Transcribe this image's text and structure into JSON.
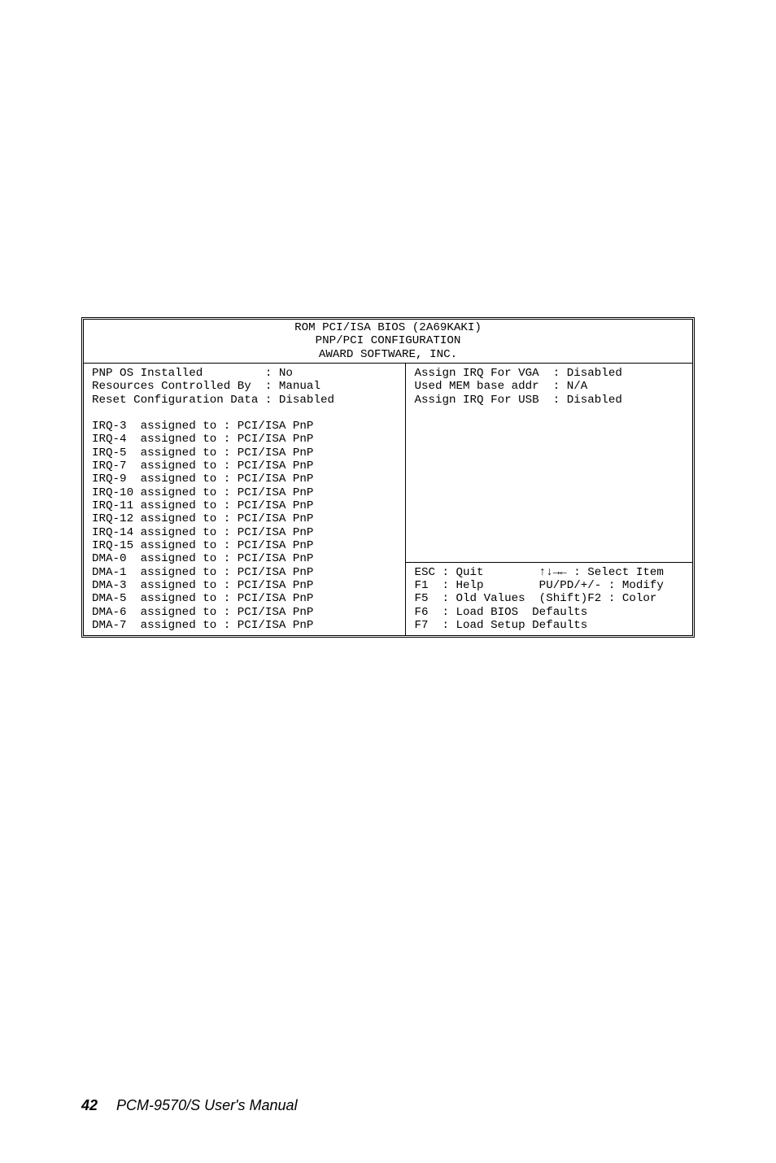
{
  "header": {
    "l1": "ROM PCI/ISA BIOS (2A69KAKI)",
    "l2": "PNP/PCI CONFIGURATION",
    "l3": "AWARD SOFTWARE, INC."
  },
  "left_top": [
    "PNP OS Installed         : No",
    "Resources Controlled By  : Manual",
    "Reset Configuration Data : Disabled"
  ],
  "left_list": [
    "IRQ-3  assigned to : PCI/ISA PnP",
    "IRQ-4  assigned to : PCI/ISA PnP",
    "IRQ-5  assigned to : PCI/ISA PnP",
    "IRQ-7  assigned to : PCI/ISA PnP",
    "IRQ-9  assigned to : PCI/ISA PnP",
    "IRQ-10 assigned to : PCI/ISA PnP",
    "IRQ-11 assigned to : PCI/ISA PnP",
    "IRQ-12 assigned to : PCI/ISA PnP",
    "IRQ-14 assigned to : PCI/ISA PnP",
    "IRQ-15 assigned to : PCI/ISA PnP",
    "DMA-0  assigned to : PCI/ISA PnP",
    "DMA-1  assigned to : PCI/ISA PnP",
    "DMA-3  assigned to : PCI/ISA PnP",
    "DMA-5  assigned to : PCI/ISA PnP",
    "DMA-6  assigned to : PCI/ISA PnP",
    "DMA-7  assigned to : PCI/ISA PnP"
  ],
  "right_top": [
    "Assign IRQ For VGA  : Disabled",
    "",
    "Used MEM base addr  : N/A",
    "",
    "Assign IRQ For USB  : Disabled"
  ],
  "right_bottom": [
    "ESC : Quit        ↑↓→← : Select Item",
    "F1  : Help        PU/PD/+/- : Modify",
    "F5  : Old Values  (Shift)F2 : Color",
    "F6  : Load BIOS  Defaults",
    "F7  : Load Setup Defaults"
  ],
  "footer": {
    "page": "42",
    "title": "PCM-9570/S  User's Manual"
  }
}
